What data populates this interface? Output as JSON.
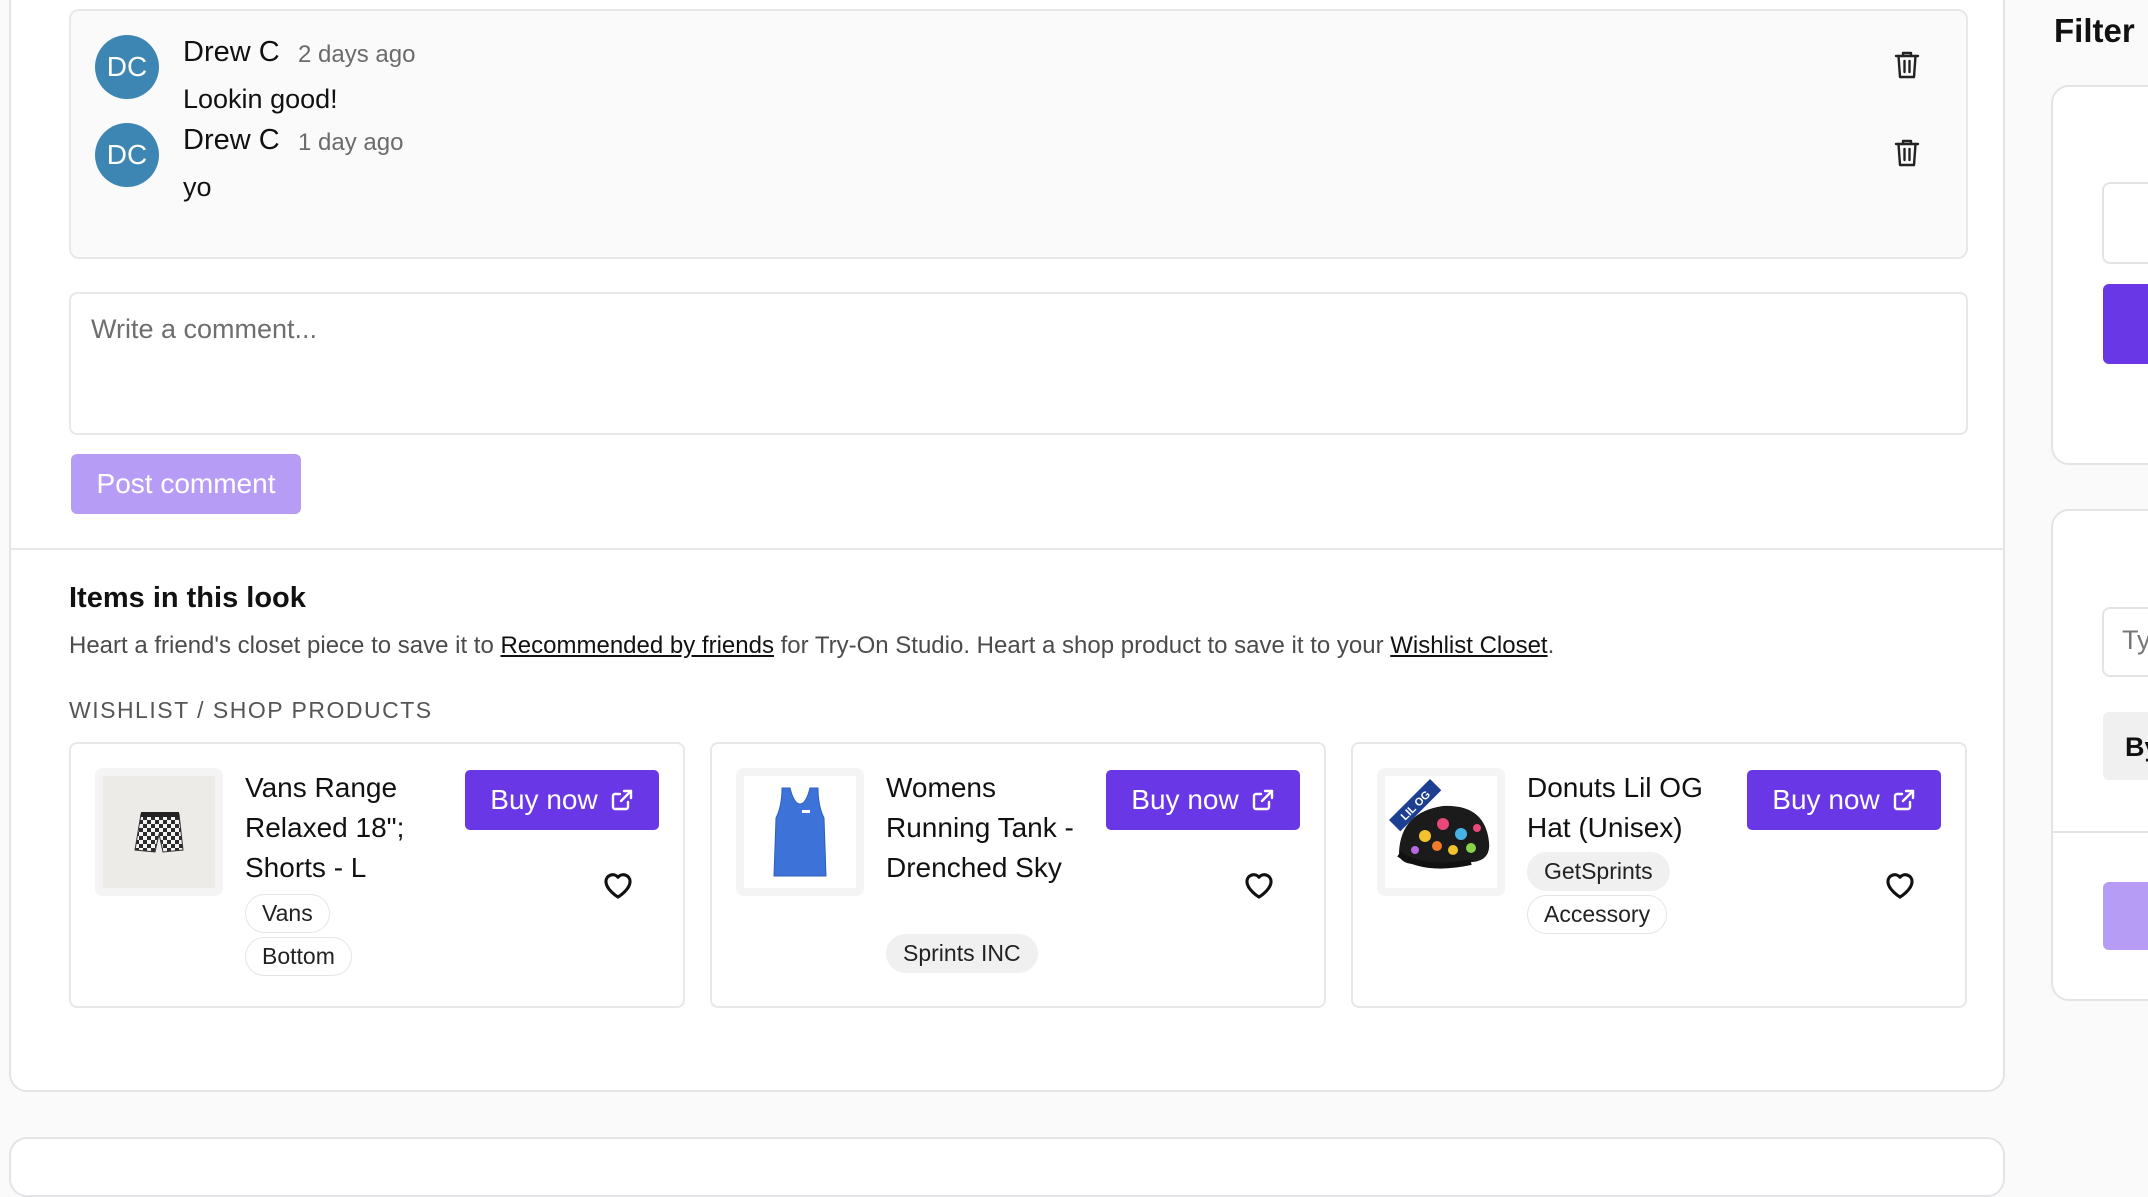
{
  "comments": [
    {
      "avatar_initials": "DC",
      "author": "Drew C",
      "time": "2 days ago",
      "text": "Lookin good!"
    },
    {
      "avatar_initials": "DC",
      "author": "Drew C",
      "time": "1 day ago",
      "text": "yo"
    }
  ],
  "comment_form": {
    "placeholder": "Write a comment...",
    "value": "",
    "post_label": "Post comment"
  },
  "items_section": {
    "title": "Items in this look",
    "desc_part1": "Heart a friend's closet piece to save it to ",
    "link_recommended": "Recommended by friends",
    "desc_part2": " for Try-On Studio. Heart a shop product to save it to your ",
    "link_wishlist": "Wishlist Closet",
    "desc_part3": ".",
    "section_label": "WISHLIST / SHOP PRODUCTS",
    "products": [
      {
        "name": "Vans Range Relaxed 18\"; Shorts - L",
        "tags": [
          "Vans",
          "Bottom"
        ],
        "buy_label": "Buy now",
        "image_icon": "shorts-image"
      },
      {
        "name": "Womens Running Tank - Drenched Sky",
        "tags": [
          "Sprints INC"
        ],
        "buy_label": "Buy now",
        "image_icon": "tank-top-image"
      },
      {
        "name": "Donuts Lil OG Hat (Unisex)",
        "tags": [
          "GetSprints",
          "Accessory"
        ],
        "buy_label": "Buy now",
        "image_icon": "hat-image"
      }
    ]
  },
  "sidebar": {
    "filter_title": "Filter",
    "input_partial": "Ty",
    "button_partial": "By"
  },
  "icons": {
    "delete": "trash-icon",
    "external": "external-link-icon",
    "favorite": "heart-icon"
  },
  "colors": {
    "accent": "#6a37e6",
    "accent_disabled": "#b79cf6",
    "avatar": "#3d86b3",
    "hat_label": "LIL OG"
  }
}
